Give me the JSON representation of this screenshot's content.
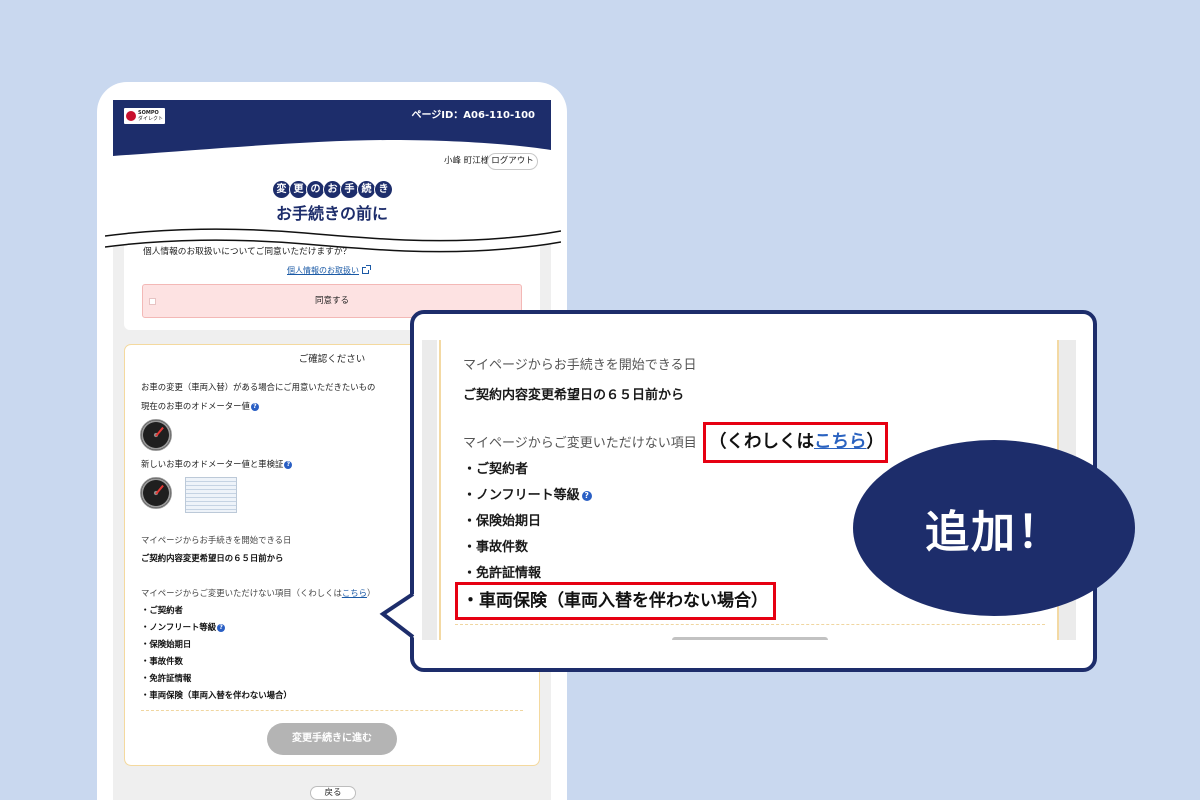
{
  "header": {
    "logo_brand": "SOMPO",
    "logo_sub": "ダイレクト",
    "page_id": "ページID：A06-110-100"
  },
  "user": {
    "name": "小峰 町江様",
    "logout": "ログアウト"
  },
  "title": {
    "badge": "変更のお手続き",
    "heading": "お手続きの前に"
  },
  "consent": {
    "question": "個人情報のお取扱いについてご同意いただけますか？",
    "link": "個人情報のお取扱い",
    "agree": "同意する"
  },
  "confirm": {
    "heading": "ご確認ください",
    "prepare_title": "お車の変更（車両入替）がある場合にご用意いただきたいもの",
    "current_odometer": "現在のお車のオドメーター値",
    "new_odometer": "新しいお車のオドメーター値と車検証",
    "start_title": "マイページからお手続きを開始できる日",
    "start_value": "ご契約内容変更希望日の６５日前から",
    "unchangeable_title": "マイページからご変更いただけない項目",
    "details_open": "（くわしくは",
    "details_link": "こちら",
    "details_close": "）",
    "items": [
      "・ご契約者",
      "・ノンフリート等級",
      "・保険始期日",
      "・事故件数",
      "・免許証情報",
      "・車両保険（車両入替を伴わない場合）"
    ]
  },
  "buttons": {
    "proceed": "変更手続きに進む",
    "back": "戻る"
  },
  "callout_badge": "追加！",
  "icons": {
    "help": "question-circle-icon",
    "external": "external-link-icon",
    "odometer": "odometer-image",
    "certificate": "vehicle-inspection-certificate-image",
    "logo": "sompo-logo-mark"
  },
  "colors": {
    "background": "#c9d8ef",
    "navy": "#1d2d6b",
    "highlight_red": "#e60012",
    "link_blue": "#1b5aa6",
    "consent_pink": "#fde2e2",
    "card_border": "#f4d99e",
    "button_disabled": "#b4b4b4"
  }
}
